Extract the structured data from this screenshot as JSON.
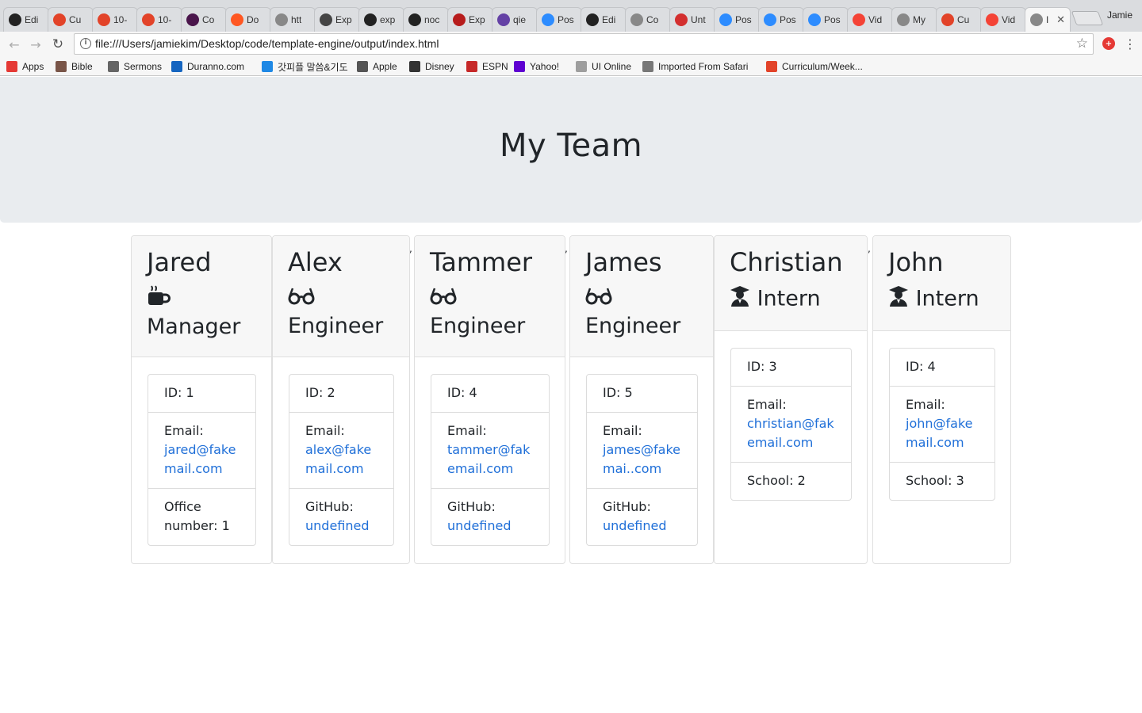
{
  "browser": {
    "tabs": [
      {
        "label": "Edi",
        "icon": "github-icon",
        "color": "#222222"
      },
      {
        "label": "Cu",
        "icon": "gitlab-icon",
        "color": "#e24329"
      },
      {
        "label": "10-",
        "icon": "gitlab-icon",
        "color": "#e24329"
      },
      {
        "label": "10-",
        "icon": "gitlab-icon",
        "color": "#e24329"
      },
      {
        "label": "Co",
        "icon": "slack-icon",
        "color": "#4a154b"
      },
      {
        "label": "Do",
        "icon": "clock-icon",
        "color": "#ff5722"
      },
      {
        "label": "htt",
        "icon": "document-icon",
        "color": "#888888"
      },
      {
        "label": "Exp",
        "icon": "express-icon",
        "color": "#444444"
      },
      {
        "label": "exp",
        "icon": "github-icon",
        "color": "#222222"
      },
      {
        "label": "noc",
        "icon": "github-icon",
        "color": "#222222"
      },
      {
        "label": "Exp",
        "icon": "pen-icon",
        "color": "#b71c1c"
      },
      {
        "label": "qie",
        "icon": "twitch-icon",
        "color": "#6441a5"
      },
      {
        "label": "Pos",
        "icon": "zoom-icon",
        "color": "#2d8cff"
      },
      {
        "label": "Edi",
        "icon": "github-icon",
        "color": "#222222"
      },
      {
        "label": "Co",
        "icon": "document-icon",
        "color": "#888888"
      },
      {
        "label": "Unt",
        "icon": "calendar-icon",
        "color": "#d32f2f"
      },
      {
        "label": "Pos",
        "icon": "zoom-icon",
        "color": "#2d8cff"
      },
      {
        "label": "Pos",
        "icon": "zoom-icon",
        "color": "#2d8cff"
      },
      {
        "label": "Pos",
        "icon": "zoom-icon",
        "color": "#2d8cff"
      },
      {
        "label": "Vid",
        "icon": "video-icon",
        "color": "#f44336"
      },
      {
        "label": "My",
        "icon": "document-icon",
        "color": "#888888"
      },
      {
        "label": "Cu",
        "icon": "gitlab-icon",
        "color": "#e24329"
      },
      {
        "label": "Vid",
        "icon": "video-icon",
        "color": "#f44336"
      },
      {
        "label": "I",
        "icon": "document-icon",
        "color": "#888888"
      }
    ],
    "profile_name": "Jamie",
    "url": "file:///Users/jamiekim/Desktop/code/template-engine/output/index.html",
    "bookmarks": [
      {
        "label": "Apps",
        "icon": "apps-grid-icon",
        "color": "#e53935"
      },
      {
        "label": "Bible",
        "icon": "book-icon",
        "color": "#795548"
      },
      {
        "label": "Sermons",
        "icon": "network-icon",
        "color": "#666666"
      },
      {
        "label": "Duranno.com",
        "icon": "duranno-icon",
        "color": "#1565c0"
      },
      {
        "label": "갓피플 말씀&기도",
        "icon": "p-icon",
        "color": "#1e88e5"
      },
      {
        "label": "Apple",
        "icon": "apple-icon",
        "color": "#555555"
      },
      {
        "label": "Disney",
        "icon": "disney-icon",
        "color": "#333333"
      },
      {
        "label": "ESPN",
        "icon": "espn-icon",
        "color": "#c62828"
      },
      {
        "label": "Yahoo!",
        "icon": "yahoo-icon",
        "color": "#5f01d1"
      },
      {
        "label": "UI Online",
        "icon": "document-icon",
        "color": "#9e9e9e"
      },
      {
        "label": "Imported From Safari",
        "icon": "folder-icon",
        "color": "#777777"
      },
      {
        "label": "Curriculum/Week...",
        "icon": "gitlab-icon",
        "color": "#e24329"
      }
    ]
  },
  "page": {
    "title": "My Team",
    "separator": ",",
    "employees": [
      {
        "name": "Jared",
        "role": "Manager",
        "role_icon": "coffee-mug-icon",
        "id_text": "ID: 1",
        "email_label": "Email:",
        "email": "jared@fakemail.com",
        "extra_label": "Office number: 1",
        "extra_link": ""
      },
      {
        "name": "Alex",
        "role": "Engineer",
        "role_icon": "glasses-icon",
        "id_text": "ID: 2",
        "email_label": "Email:",
        "email": "alex@fakemail.com",
        "extra_label": "GitHub:",
        "extra_link": "undefined"
      },
      {
        "name": "Tammer",
        "role": "Engineer",
        "role_icon": "glasses-icon",
        "id_text": "ID: 4",
        "email_label": "Email:",
        "email": "tammer@fakemail.com",
        "extra_label": "GitHub:",
        "extra_link": "undefined"
      },
      {
        "name": "James",
        "role": "Engineer",
        "role_icon": "glasses-icon",
        "id_text": "ID: 5",
        "email_label": "Email:",
        "email": "james@fakemai..com",
        "extra_label": "GitHub:",
        "extra_link": "undefined"
      },
      {
        "name": "Christian",
        "role": "Intern",
        "role_icon": "graduate-icon",
        "id_text": "ID: 3",
        "email_label": "Email:",
        "email": "christian@fakemail.com",
        "extra_label": "School: 2",
        "extra_link": ""
      },
      {
        "name": "John",
        "role": "Intern",
        "role_icon": "graduate-icon",
        "id_text": "ID: 4",
        "email_label": "Email:",
        "email": "john@fakemail.com",
        "extra_label": "School: 3",
        "extra_link": ""
      }
    ]
  },
  "colors": {
    "jumbotron_bg": "#e9ecef",
    "link": "#1f6fd8",
    "card_header_bg": "#f7f7f7"
  }
}
